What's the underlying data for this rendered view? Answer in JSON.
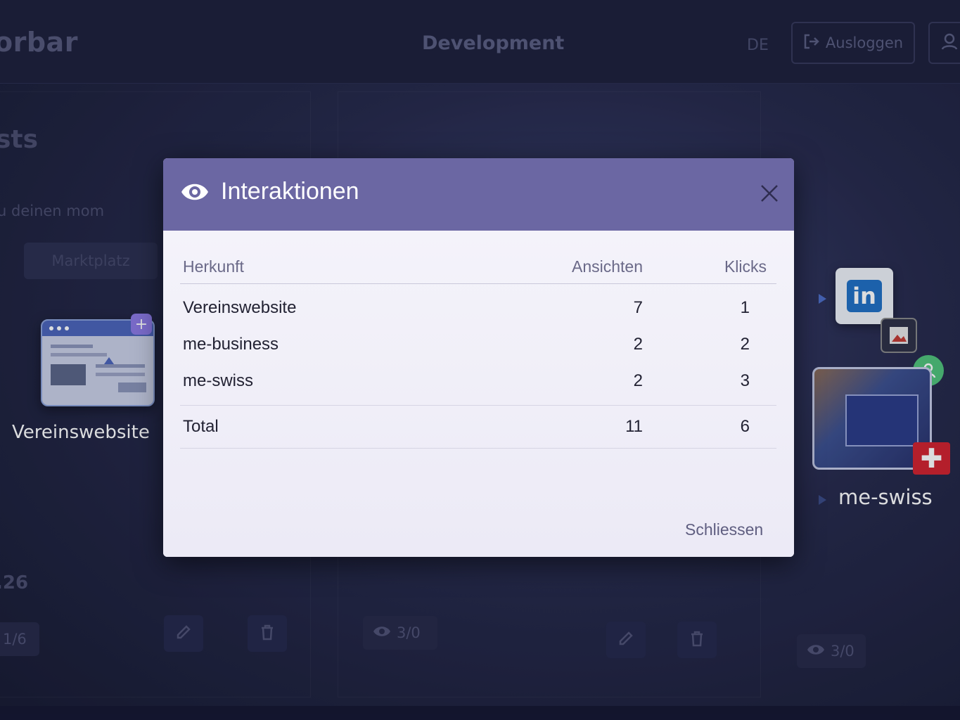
{
  "app": {
    "brand": "orbar",
    "environment": "Development",
    "language": "DE",
    "logout_label": "Ausloggen"
  },
  "background": {
    "heading": "sts",
    "subtitle": "u deinen mom",
    "tab_label": "Marktplatz",
    "number": ".26",
    "stat_left": "1/6",
    "stat_middle": "3/0",
    "stat_right": "3/0"
  },
  "channels": {
    "left_label": "Vereinswebsite",
    "right_label": "me-swiss",
    "linkedin_text": "in"
  },
  "modal": {
    "title": "Interaktionen",
    "columns": {
      "source": "Herkunft",
      "views": "Ansichten",
      "clicks": "Klicks"
    },
    "rows": [
      {
        "source": "Vereinswebsite",
        "views": "7",
        "clicks": "1"
      },
      {
        "source": "me-business",
        "views": "2",
        "clicks": "2"
      },
      {
        "source": "me-swiss",
        "views": "2",
        "clicks": "3"
      }
    ],
    "total": {
      "label": "Total",
      "views": "11",
      "clicks": "6"
    },
    "close_label": "Schliessen"
  },
  "colors": {
    "modal_header": "#6b67a3",
    "background": "#252849",
    "swiss_red": "#d2222d",
    "linkedin_blue": "#1f6fc4",
    "user_badge": "#4fc27a"
  },
  "icons": {
    "header": "eye-icon",
    "close": "close-icon",
    "logout": "logout-icon",
    "user": "user-icon",
    "edit": "edit-icon",
    "delete": "trash-icon"
  }
}
